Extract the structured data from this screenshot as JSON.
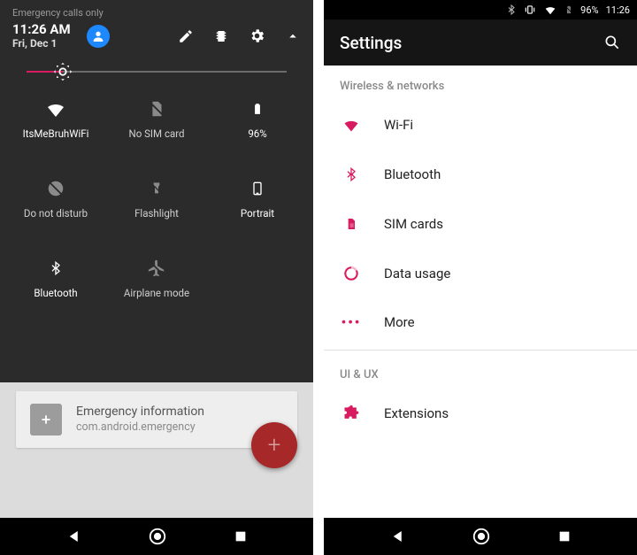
{
  "left": {
    "status_text": "Emergency calls only",
    "time": "11:26 AM",
    "date": "Fri, Dec 1",
    "brightness_percent": 14,
    "tiles": [
      {
        "label": "ItsMeBruhWiFi",
        "icon": "wifi",
        "active": true
      },
      {
        "label": "No SIM card",
        "icon": "no-sim",
        "active": false
      },
      {
        "label": "96%",
        "icon": "battery",
        "active": true
      },
      {
        "label": "Do not disturb",
        "icon": "dnd-off",
        "active": false
      },
      {
        "label": "Flashlight",
        "icon": "flashlight-off",
        "active": false
      },
      {
        "label": "Portrait",
        "icon": "portrait",
        "active": true
      },
      {
        "label": "Bluetooth",
        "icon": "bluetooth",
        "active": true
      },
      {
        "label": "Airplane mode",
        "icon": "airplane-off",
        "active": false
      }
    ],
    "notification": {
      "title": "Emergency information",
      "subtitle": "com.android.emergency"
    }
  },
  "right": {
    "status": {
      "battery_text": "96%",
      "time": "11:26"
    },
    "app_title": "Settings",
    "section1": "Wireless & networks",
    "section2": "UI & UX",
    "items1": [
      {
        "label": "Wi-Fi",
        "icon": "wifi"
      },
      {
        "label": "Bluetooth",
        "icon": "bluetooth"
      },
      {
        "label": "SIM cards",
        "icon": "sim"
      },
      {
        "label": "Data usage",
        "icon": "data"
      },
      {
        "label": "More",
        "icon": "more"
      }
    ],
    "items2": [
      {
        "label": "Extensions",
        "icon": "extension"
      }
    ]
  },
  "colors": {
    "accent": "#d81b60"
  }
}
